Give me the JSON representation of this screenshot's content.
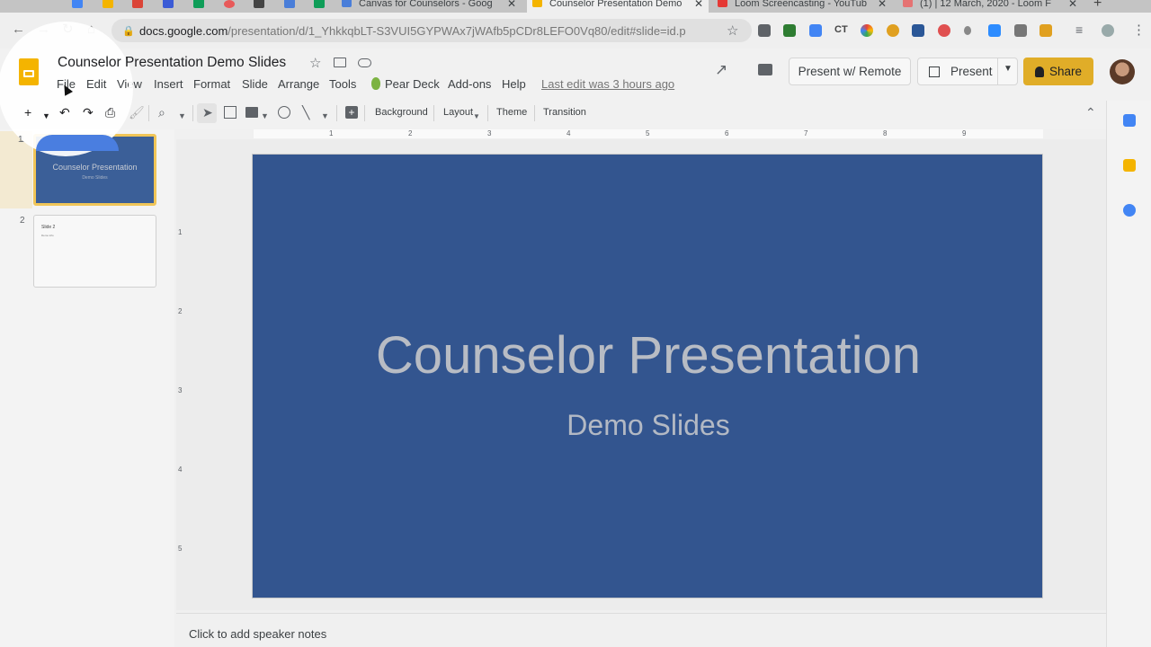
{
  "browser": {
    "tabs": [
      {
        "title": "Canvas for Counselors - Goog",
        "favicon_color": "#4a7ed9",
        "favicon": "docs-favicon-icon"
      },
      {
        "title": "Counselor Presentation Demo",
        "favicon_color": "#f4b400",
        "favicon": "slides-favicon-icon",
        "active": true
      },
      {
        "title": "Loom Screencasting - YouTub",
        "favicon_color": "#e53935",
        "favicon": "youtube-favicon-icon"
      },
      {
        "title": "(1) | 12 March, 2020 - Loom F",
        "favicon_color": "#e57373",
        "favicon": "loom-favicon-icon"
      }
    ],
    "tab_close": "✕",
    "new_tab": "+",
    "url_host": "docs.google.com",
    "url_path": "/presentation/d/1_YhkkqbLT-S3VUI5GYPWAx7jWAfb5pCDr8LEFO0Vq80/edit#slide=id.p",
    "extensions": [
      "gmail-icon",
      "180-icon",
      "drive-icon",
      "ct-icon",
      "color-icon",
      "orange-icon",
      "wc-icon",
      "lock-icon",
      "leaf-icon",
      "zoom-icon",
      "camera-icon",
      "thumb-icon"
    ]
  },
  "doc": {
    "title": "Counselor Presentation Demo Slides",
    "menu": [
      "File",
      "Edit",
      "View",
      "Insert",
      "Format",
      "Slide",
      "Arrange",
      "Tools",
      "Pear Deck",
      "Add-ons",
      "Help"
    ],
    "last_edit": "Last edit was 3 hours ago"
  },
  "actions": {
    "present_remote": "Present w/ Remote",
    "present": "Present",
    "share": "Share"
  },
  "toolbar": {
    "background": "Background",
    "layout": "Layout",
    "theme": "Theme",
    "transition": "Transition"
  },
  "ruler": {
    "h": [
      "1",
      "2",
      "3",
      "4",
      "5",
      "6",
      "7",
      "8",
      "9"
    ],
    "v": [
      "1",
      "2",
      "3",
      "4",
      "5"
    ]
  },
  "slides": [
    {
      "number": "1",
      "title": "Counselor Presentation",
      "subtitle": "Demo Slides"
    },
    {
      "number": "2",
      "title": "Slide 2",
      "subtitle": "Demo info"
    }
  ],
  "current_slide": {
    "title": "Counselor Presentation",
    "subtitle": "Demo Slides",
    "background": "#33558f"
  },
  "notes_placeholder": "Click to add speaker notes"
}
